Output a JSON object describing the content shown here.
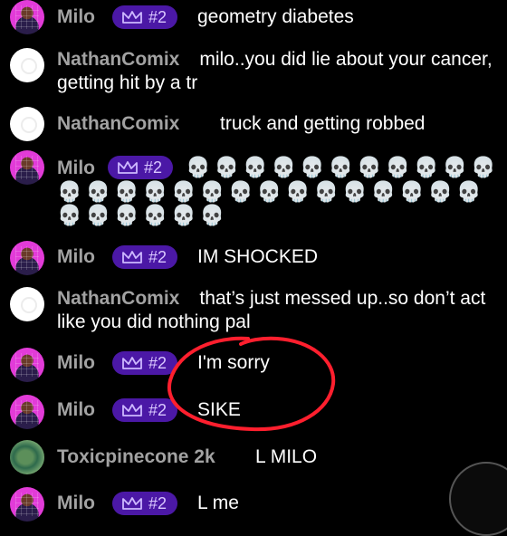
{
  "messages": [
    {
      "user": "Milo",
      "badge": "#2",
      "text": "geometry diabetes"
    },
    {
      "user": "NathanComix",
      "text": "milo..you did lie about your cancer, getting hit by a tr"
    },
    {
      "user": "NathanComix",
      "text": "truck and getting robbed"
    },
    {
      "user": "Milo",
      "badge": "#2",
      "text": "💀 💀 💀 💀 💀 💀 💀 💀 💀 💀 💀 💀 💀 💀 💀 💀 💀 💀 💀 💀 💀 💀 💀 💀 💀 💀 💀 💀 💀 💀 💀 💀"
    },
    {
      "user": "Milo",
      "badge": "#2",
      "text": "IM SHOCKED"
    },
    {
      "user": "NathanComix",
      "text": "that’s just messed up..so don’t act like you did nothing pal"
    },
    {
      "user": "Milo",
      "badge": "#2",
      "text": "I'm sorry"
    },
    {
      "user": "Milo",
      "badge": "#2",
      "text": "SIKE"
    },
    {
      "user": "Toxicpinecone 2k",
      "text": "L MILO"
    },
    {
      "user": "Milo",
      "badge": "#2",
      "text": "L me"
    }
  ],
  "colors": {
    "background": "#000000",
    "username": "#a2a2a2",
    "badge_bg": "#4b18a6",
    "badge_text": "#d9c7ff",
    "annotation": "#ff1f2e"
  },
  "icons": {
    "badge": "crown-icon"
  }
}
